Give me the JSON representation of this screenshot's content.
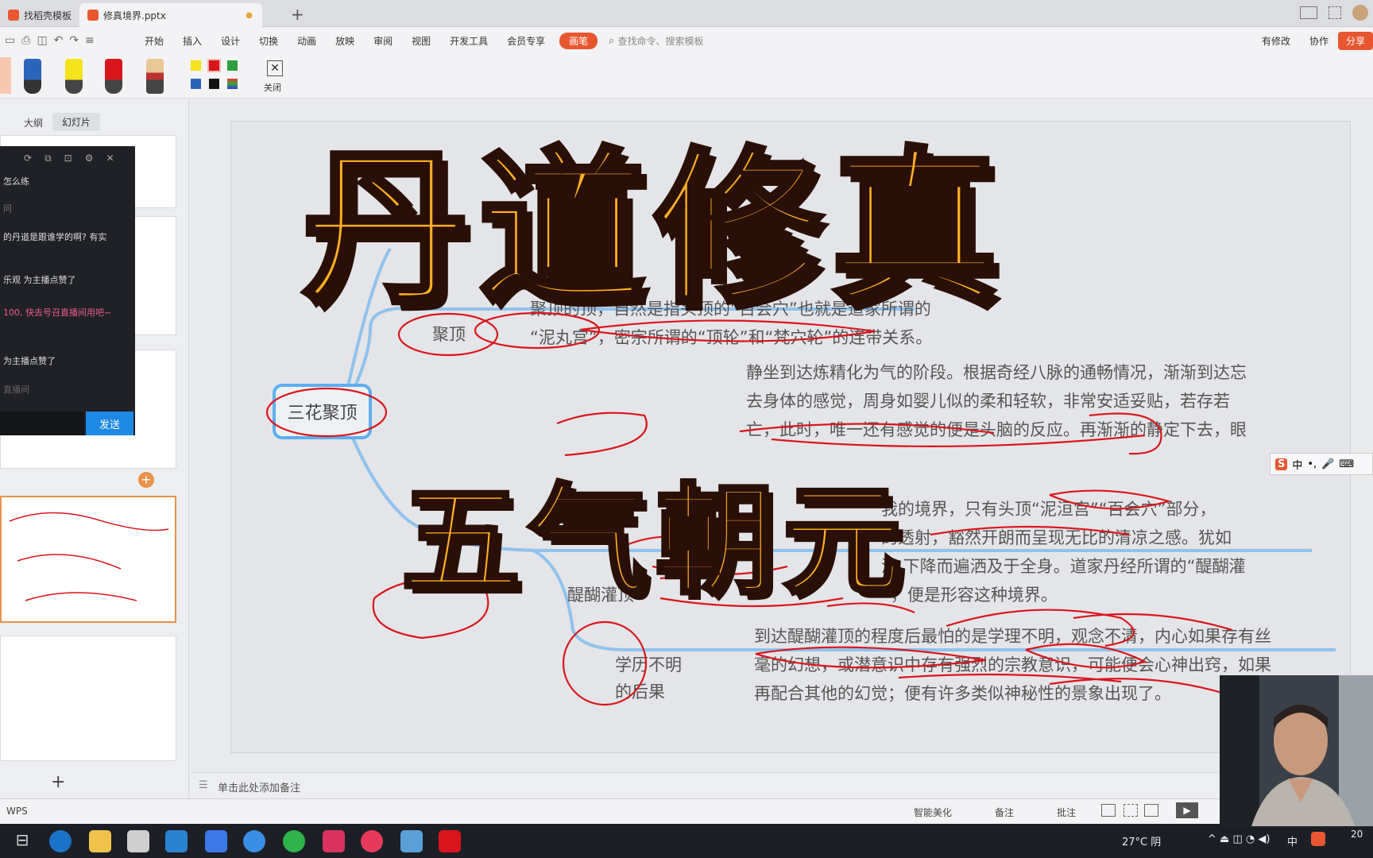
{
  "tabs": [
    {
      "label": "找稻壳模板"
    },
    {
      "label": "修真境界.pptx"
    }
  ],
  "menu": [
    "开始",
    "插入",
    "设计",
    "切换",
    "动画",
    "放映",
    "审阅",
    "视图",
    "开发工具",
    "会员专享",
    "画笔"
  ],
  "search_placeholder": "查找命令、搜索模板",
  "right_menu": {
    "has_changes": "有修改",
    "collab": "协作",
    "share": "分享"
  },
  "pen_toolbar": {
    "close": "关闭"
  },
  "sidebar": {
    "tab_outline": "大纲",
    "tab_slides": "幻灯片",
    "add": "+"
  },
  "chat": {
    "lines": [
      "怎么练",
      "问",
      "的丹道是跟谁学的啊? 有实",
      "乐观 为主播点赞了",
      "100, 快去号召直播间用吧~",
      "为主播点赞了",
      "直播间"
    ],
    "send": "发送"
  },
  "mindmap": {
    "root": "三花聚顶",
    "sub_juding": "聚顶",
    "sub_tihu": "醍醐灌顶",
    "sub_xueli": [
      "学历不明",
      "的后果"
    ],
    "para_top": [
      "聚顶的顶，自然是指头顶的“百会穴”也就是道家所谓的",
      "“泥丸宫”，密宗所谓的“顶轮”和“梵穴轮”的连带关系。"
    ],
    "para_mid": [
      "静坐到达炼精化为气的阶段。根据奇经八脉的通畅情况，渐渐到达忘",
      "去身体的感觉，周身如婴儿似的柔和轻软，非常安适妥贴，若存若",
      "亡，此时，唯一还有感觉的便是头脑的反应。再渐渐的静定下去，眼"
    ],
    "para_lower": [
      "我的境界，只有头顶“泥洹宫”“百会穴”部分，",
      "的透射，豁然开朗而呈现无比的清凉之感。犹如",
      "清       下降而遍洒及于全身。道家丹经所谓的“醍醐灌",
      "顶”，便是形容这种境界。"
    ],
    "para_bottom": [
      "到达醍醐灌顶的程度后最怕的是学理不明，观念不清，内心如果存有丝",
      "毫的幻想，或潜意识中存有强烈的宗教意识，可能便会心神出窍，如果",
      "再配合其他的幻觉；便有许多类似神秘性的景象出现了。"
    ]
  },
  "overlay": {
    "title_main": "丹道修真",
    "title_sub": "五气朝元"
  },
  "ime": {
    "label": "中"
  },
  "notes_placeholder": "单击此处添加备注",
  "status": {
    "app": "WPS",
    "beautify": "智能美化",
    "notes": "备注",
    "comments": "批注"
  },
  "taskbar": {
    "weather": "27°C 阴",
    "ime": "中",
    "clock": "20"
  },
  "colors": {
    "accent": "#e8572f",
    "mind_blue": "#5eaef0",
    "ink_red": "#d9161c",
    "title_fill": "#ffb020"
  }
}
